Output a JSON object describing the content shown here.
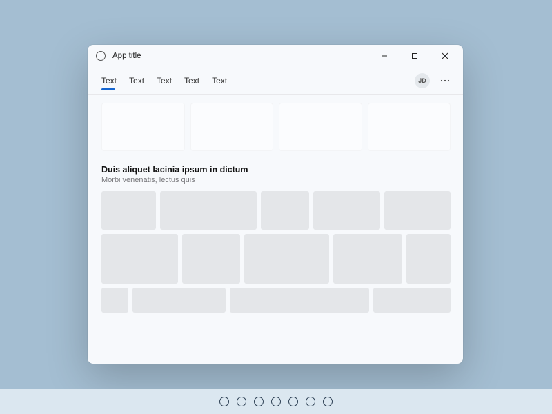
{
  "titlebar": {
    "app_title": "App title"
  },
  "tabs": [
    {
      "label": "Text",
      "active": true
    },
    {
      "label": "Text",
      "active": false
    },
    {
      "label": "Text",
      "active": false
    },
    {
      "label": "Text",
      "active": false
    },
    {
      "label": "Text",
      "active": false
    }
  ],
  "avatar": {
    "initials": "JD"
  },
  "section": {
    "title": "Duis aliquet lacinia ipsum in dictum",
    "subtitle": "Morbi venenatis, lectus quis"
  },
  "taskbar": {
    "item_count": 7
  }
}
